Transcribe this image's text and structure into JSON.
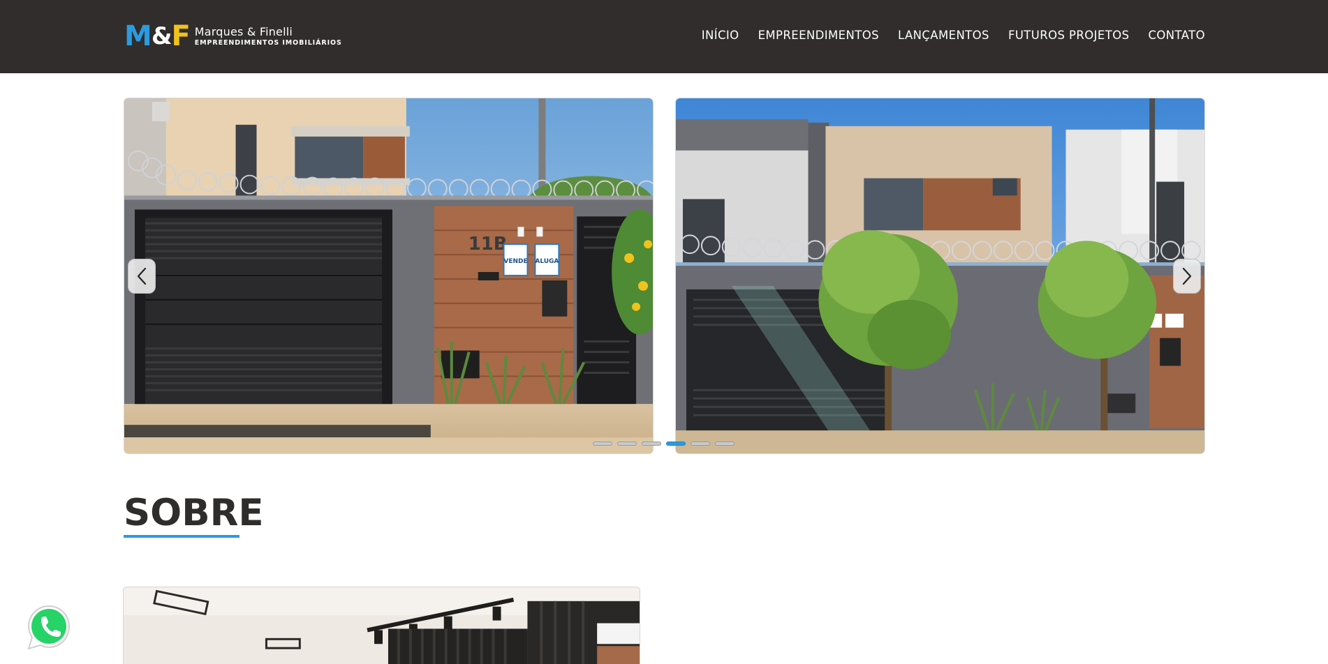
{
  "header": {
    "logo": {
      "mark_m": "M",
      "mark_amp": "&",
      "mark_f": "F",
      "name": "Marques & Finelli",
      "subtitle": "EMPREENDIMENTOS IMOBILIÁRIOS"
    },
    "nav": [
      {
        "label": "INÍCIO"
      },
      {
        "label": "EMPREENDIMENTOS"
      },
      {
        "label": "LANÇAMENTOS"
      },
      {
        "label": "FUTUROS PROJETOS"
      },
      {
        "label": "CONTATO"
      }
    ]
  },
  "carousel": {
    "slide_count": 6,
    "active_index": 3,
    "slides": [
      {
        "sign_left": "VENDE",
        "sign_right": "ALUGA",
        "house_number": "11B"
      },
      {}
    ]
  },
  "about": {
    "title": "SOBRE"
  },
  "icons": {
    "prev": "chevron-left-icon",
    "next": "chevron-right-icon",
    "whatsapp": "whatsapp-icon"
  },
  "colors": {
    "header_bg": "#302d2c",
    "accent_blue": "#2b9be0",
    "accent_yellow": "#f2c21c",
    "whatsapp_green": "#25d366"
  }
}
